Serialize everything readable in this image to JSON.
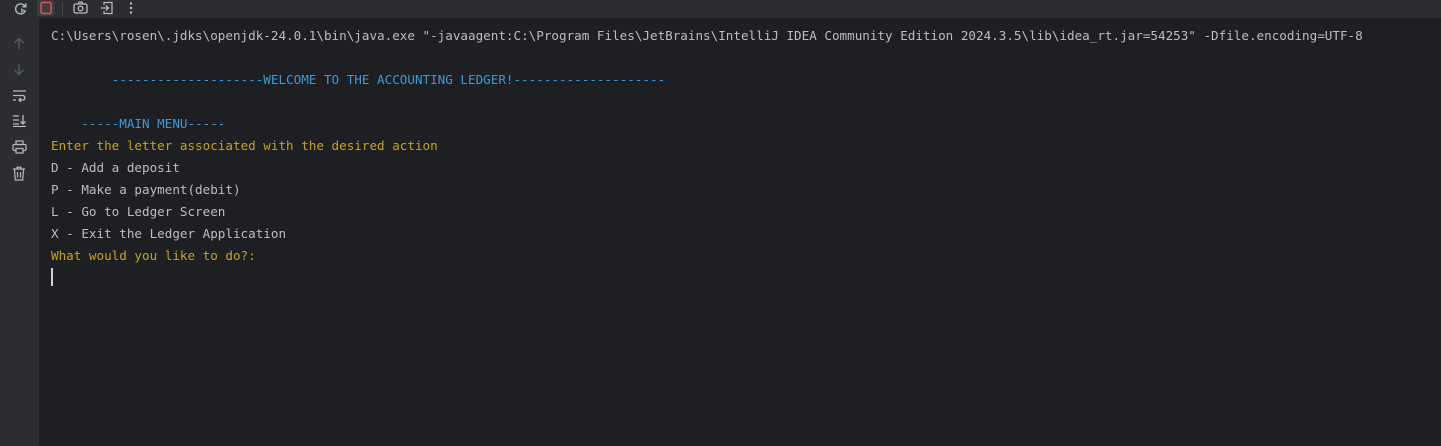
{
  "toolbar": {
    "buttons": [
      "rerun-icon",
      "stop-icon",
      "camera-icon",
      "exit-icon",
      "more-vertical-icon"
    ],
    "stop_color": "#e05555",
    "rerun_color": "#5fb865"
  },
  "gutter": {
    "buttons": [
      "arrow-up-icon",
      "arrow-down-icon",
      "soft-wrap-icon",
      "scroll-to-end-icon",
      "print-icon",
      "trash-icon"
    ]
  },
  "console": {
    "lines": [
      {
        "text": "C:\\Users\\rosen\\.jdks\\openjdk-24.0.1\\bin\\java.exe \"-javaagent:C:\\Program Files\\JetBrains\\IntelliJ IDEA Community Edition 2024.3.5\\lib\\idea_rt.jar=54253\" -Dfile.encoding=UTF-8",
        "style": "normal"
      },
      {
        "text": "",
        "style": "normal"
      },
      {
        "text": "        --------------------WELCOME TO THE ACCOUNTING LEDGER!--------------------",
        "style": "blue"
      },
      {
        "text": "",
        "style": "normal"
      },
      {
        "text": "    -----MAIN MENU-----",
        "style": "blue"
      },
      {
        "text": "Enter the letter associated with the desired action",
        "style": "gold"
      },
      {
        "text": "D - Add a deposit",
        "style": "normal"
      },
      {
        "text": "P - Make a payment(debit)",
        "style": "normal"
      },
      {
        "text": "L - Go to Ledger Screen",
        "style": "normal"
      },
      {
        "text": "X - Exit the Ledger Application",
        "style": "normal"
      },
      {
        "text": "What would you like to do?:",
        "style": "gold"
      }
    ]
  },
  "colors": {
    "background": "#1e1f22",
    "text": "#bcbec4",
    "blue": "#3d9ad8",
    "gold": "#c9a11c"
  }
}
